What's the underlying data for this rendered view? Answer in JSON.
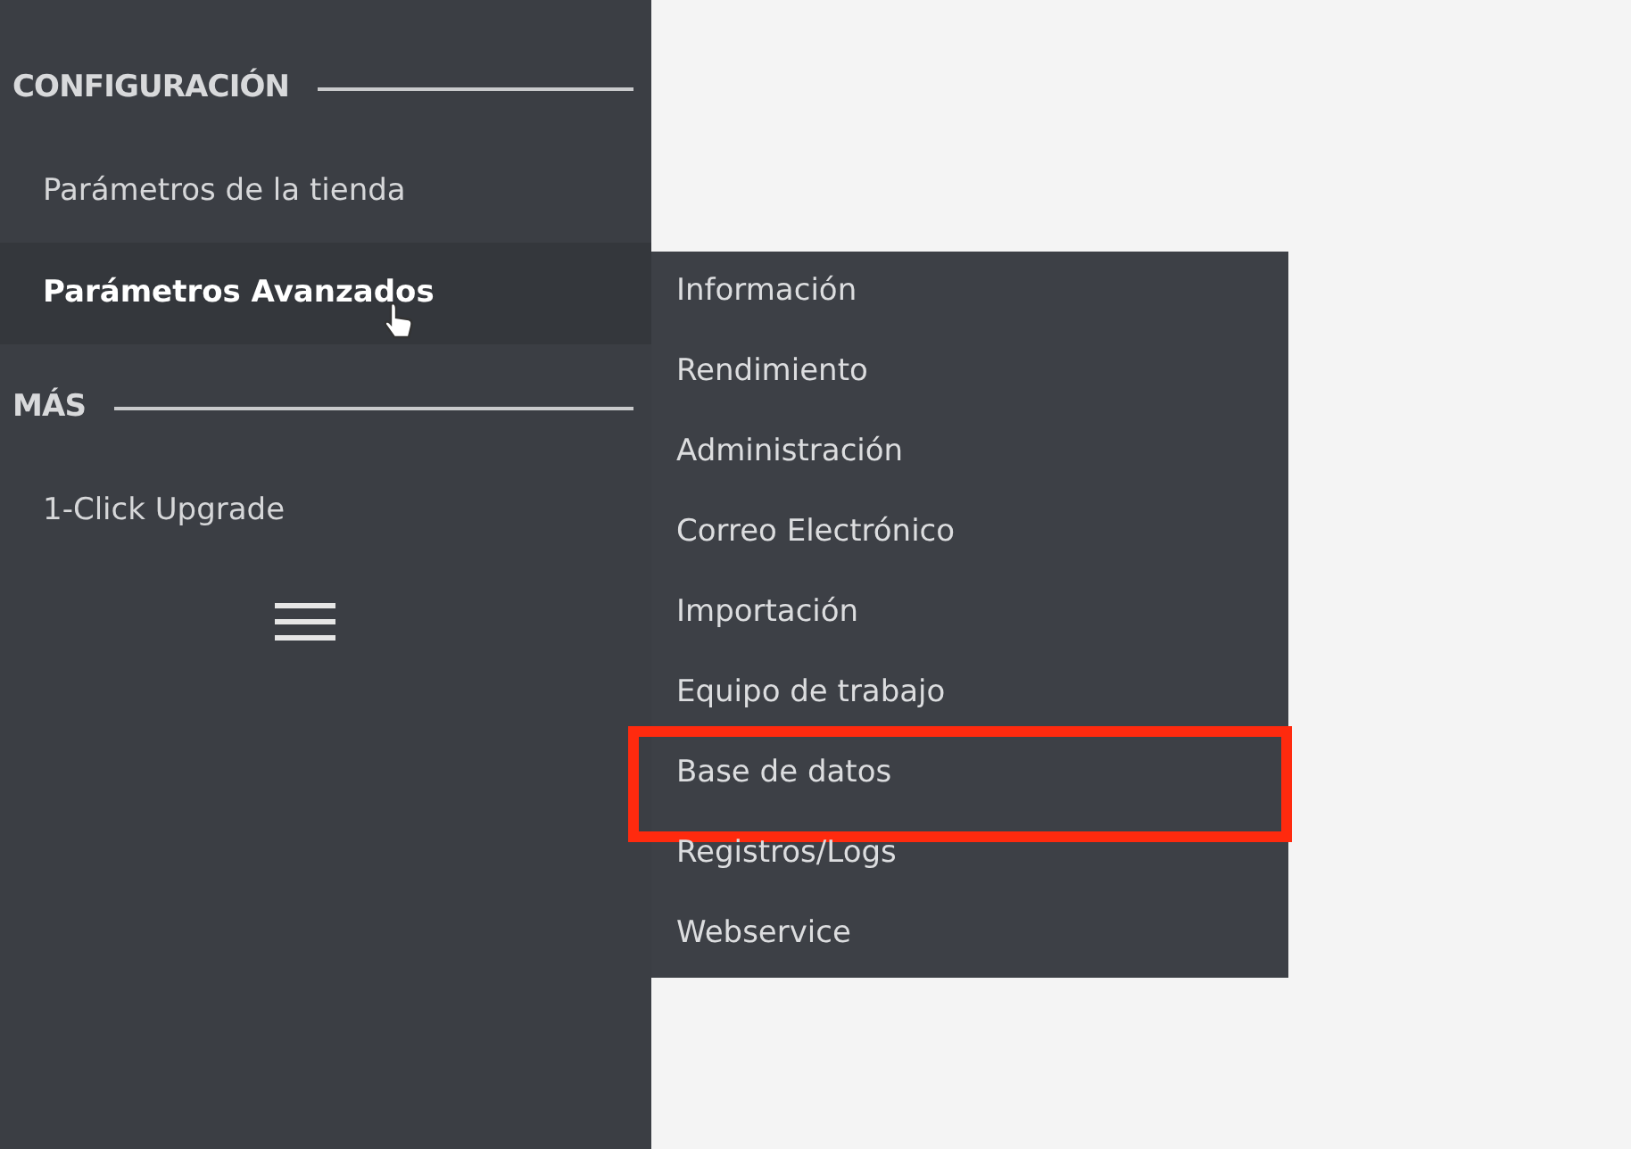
{
  "sidebar": {
    "sections": [
      {
        "title": "CONFIGURACIÓN",
        "items": [
          {
            "label": "Parámetros de la tienda",
            "selected": false
          },
          {
            "label": "Parámetros Avanzados",
            "selected": true
          }
        ]
      },
      {
        "title": "MÁS",
        "items": [
          {
            "label": "1-Click Upgrade",
            "selected": false
          }
        ]
      }
    ]
  },
  "submenu": {
    "items": [
      {
        "label": "Información",
        "highlighted": false
      },
      {
        "label": "Rendimiento",
        "highlighted": false
      },
      {
        "label": "Administración",
        "highlighted": false
      },
      {
        "label": "Correo Electrónico",
        "highlighted": false
      },
      {
        "label": "Importación",
        "highlighted": false
      },
      {
        "label": "Equipo de trabajo",
        "highlighted": false
      },
      {
        "label": "Base de datos",
        "highlighted": true
      },
      {
        "label": "Registros/Logs",
        "highlighted": false
      },
      {
        "label": "Webservice",
        "highlighted": false
      }
    ]
  }
}
